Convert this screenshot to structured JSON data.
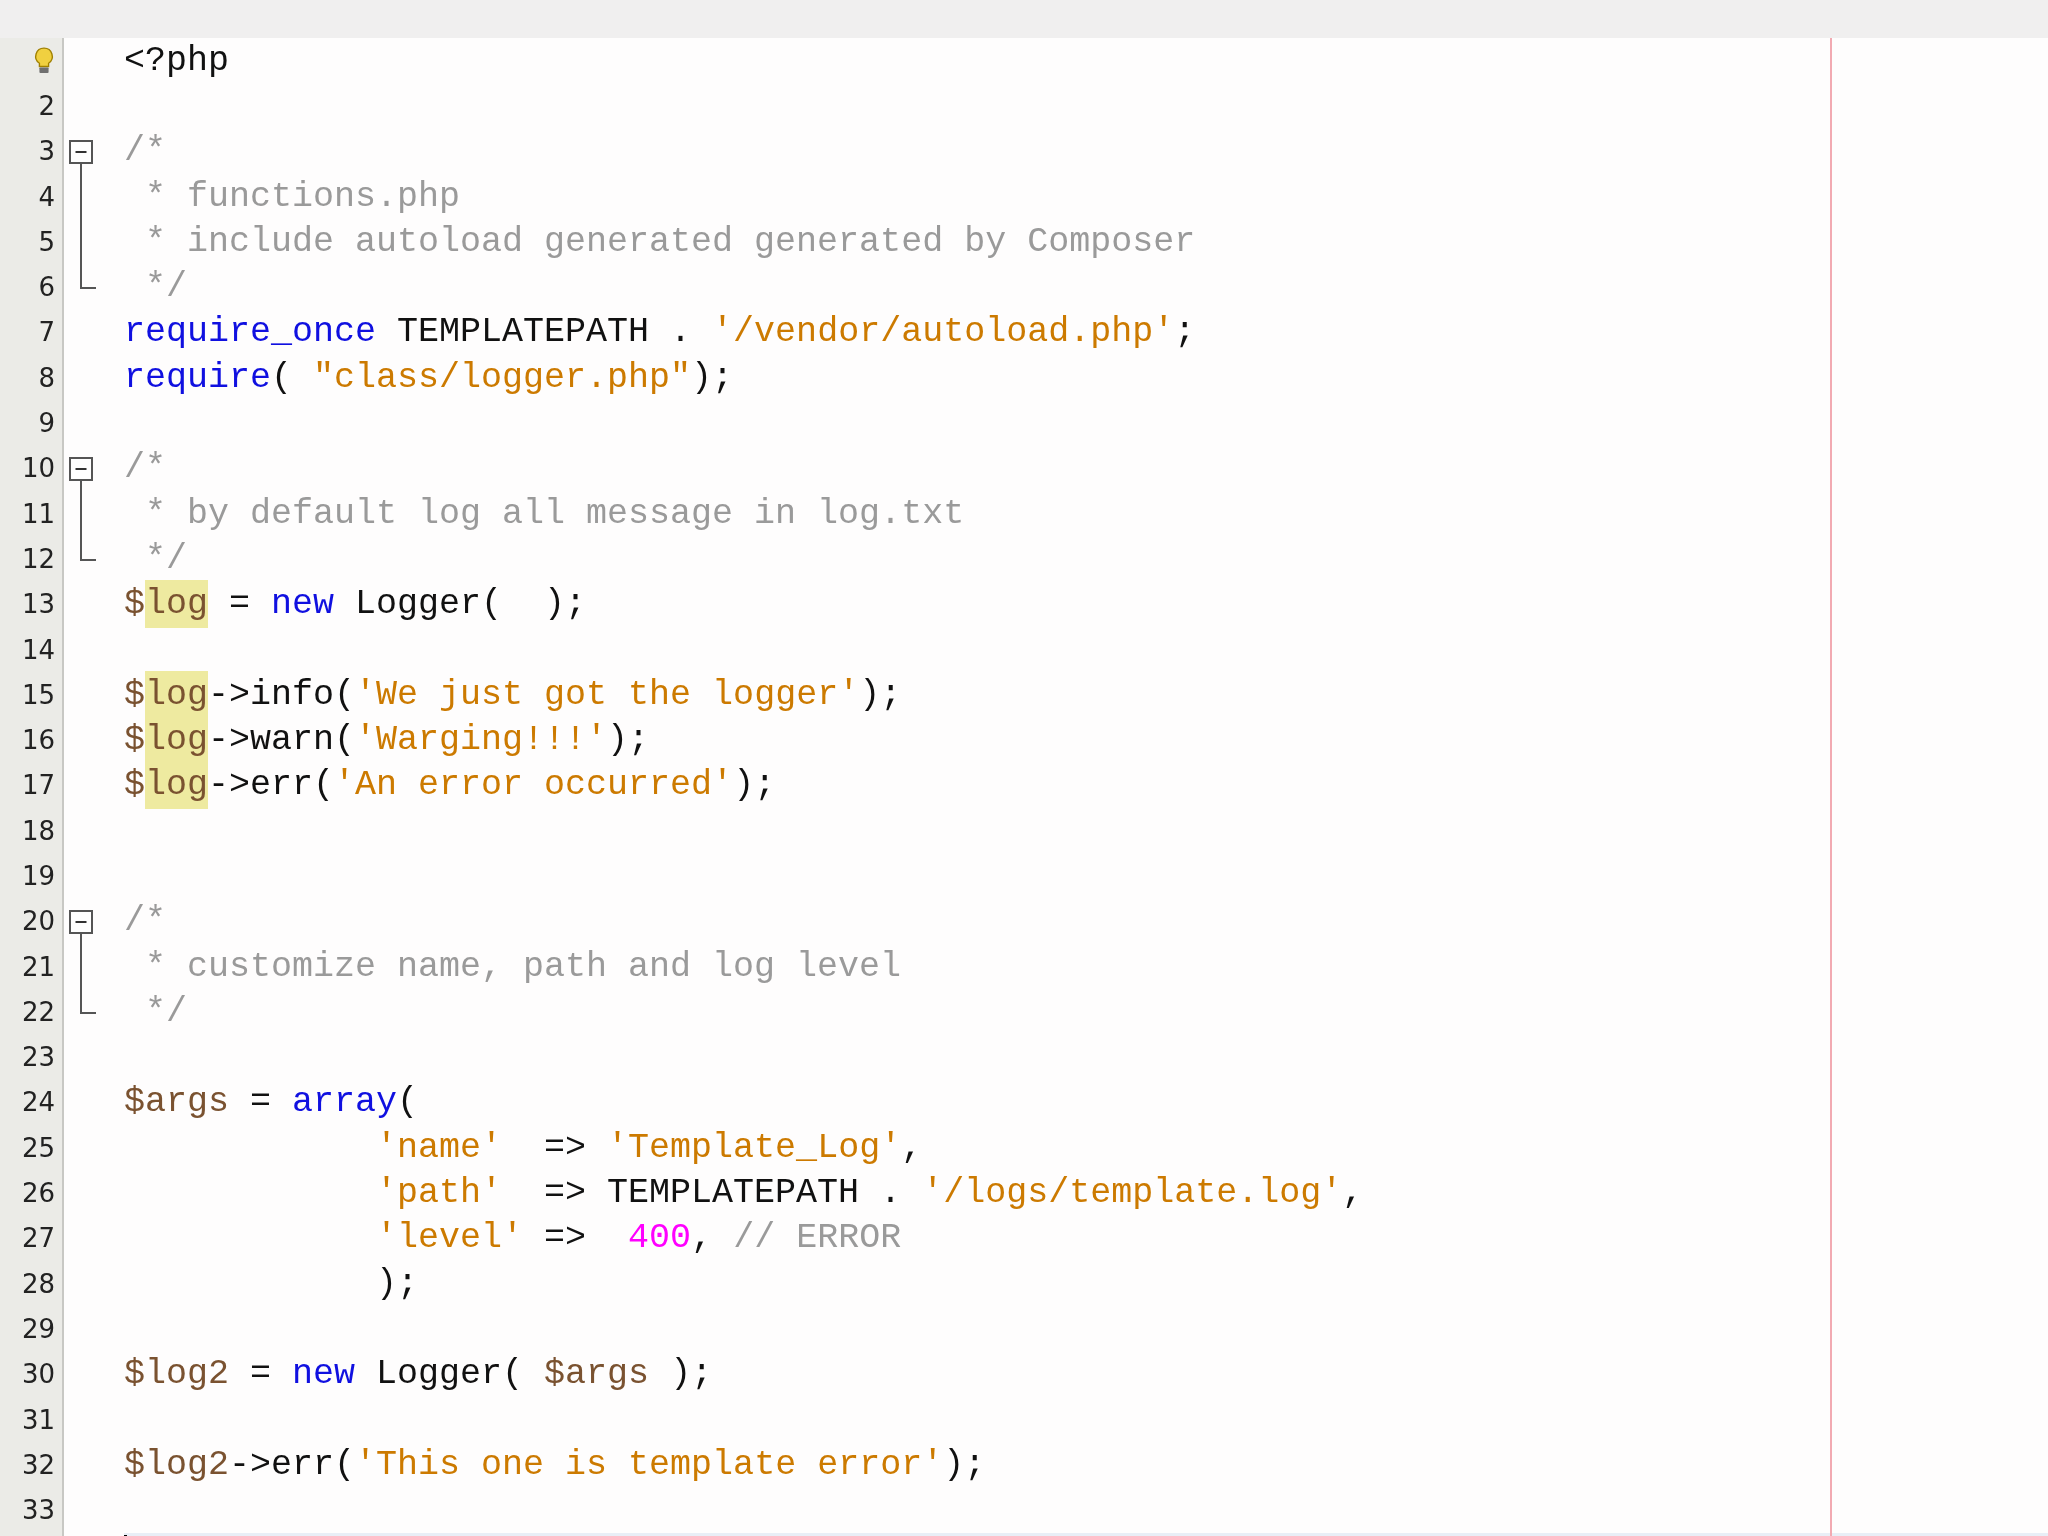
{
  "editor": {
    "lines": [
      {
        "hint": true,
        "kind": "plain",
        "tokens": [
          {
            "t": "<?php",
            "kind": "txt"
          }
        ]
      },
      {
        "number": "2",
        "kind": "plain"
      },
      {
        "number": "3",
        "kind": "fold_start",
        "tokens": [
          {
            "t": "/*",
            "kind": "com"
          }
        ]
      },
      {
        "number": "4",
        "kind": "fold_body",
        "tokens": [
          {
            "t": " * functions.php",
            "kind": "com"
          }
        ]
      },
      {
        "number": "5",
        "kind": "fold_body",
        "tokens": [
          {
            "t": " * include autoload generated generated by Composer",
            "kind": "com"
          }
        ]
      },
      {
        "number": "6",
        "kind": "fold_end",
        "tokens": [
          {
            "t": " */",
            "kind": "com"
          }
        ]
      },
      {
        "number": "7",
        "kind": "plain",
        "tokens": [
          {
            "t": "require_once",
            "kind": "kw"
          },
          {
            "t": " TEMPLATEPATH . ",
            "kind": "txt"
          },
          {
            "t": "'/vendor/autoload.php'",
            "kind": "str"
          },
          {
            "t": ";",
            "kind": "txt"
          }
        ]
      },
      {
        "number": "8",
        "kind": "plain",
        "tokens": [
          {
            "t": "require",
            "kind": "kw"
          },
          {
            "t": "( ",
            "kind": "txt"
          },
          {
            "t": "\"class/logger.php\"",
            "kind": "str"
          },
          {
            "t": ");",
            "kind": "txt"
          }
        ]
      },
      {
        "number": "9",
        "kind": "plain"
      },
      {
        "number": "10",
        "kind": "fold_start",
        "tokens": [
          {
            "t": "/*",
            "kind": "com"
          }
        ]
      },
      {
        "number": "11",
        "kind": "fold_body",
        "tokens": [
          {
            "t": " * by default log all message in log.txt",
            "kind": "com"
          }
        ]
      },
      {
        "number": "12",
        "kind": "fold_end",
        "tokens": [
          {
            "t": " */",
            "kind": "com"
          }
        ]
      },
      {
        "number": "13",
        "kind": "plain",
        "tokens": [
          {
            "t": "$",
            "kind": "var"
          },
          {
            "t": "log",
            "kind": "var",
            "highlighted": true
          },
          {
            "t": " = ",
            "kind": "txt"
          },
          {
            "t": "new",
            "kind": "kw"
          },
          {
            "t": " Logger(  );",
            "kind": "txt"
          }
        ]
      },
      {
        "number": "14",
        "kind": "plain"
      },
      {
        "number": "15",
        "kind": "plain",
        "tokens": [
          {
            "t": "$",
            "kind": "var"
          },
          {
            "t": "log",
            "kind": "var",
            "highlighted": true
          },
          {
            "t": "->info(",
            "kind": "txt"
          },
          {
            "t": "'We just got the logger'",
            "kind": "str"
          },
          {
            "t": ");",
            "kind": "txt"
          }
        ]
      },
      {
        "number": "16",
        "kind": "plain",
        "tokens": [
          {
            "t": "$",
            "kind": "var"
          },
          {
            "t": "log",
            "kind": "var",
            "highlighted": true
          },
          {
            "t": "->warn(",
            "kind": "txt"
          },
          {
            "t": "'Warging!!!'",
            "kind": "str"
          },
          {
            "t": ");",
            "kind": "txt"
          }
        ]
      },
      {
        "number": "17",
        "kind": "plain",
        "tokens": [
          {
            "t": "$",
            "kind": "var"
          },
          {
            "t": "log",
            "kind": "var",
            "highlighted": true
          },
          {
            "t": "->err(",
            "kind": "txt"
          },
          {
            "t": "'An error occurred'",
            "kind": "str"
          },
          {
            "t": ");",
            "kind": "txt"
          }
        ]
      },
      {
        "number": "18",
        "kind": "plain"
      },
      {
        "number": "19",
        "kind": "plain"
      },
      {
        "number": "20",
        "kind": "fold_start",
        "tokens": [
          {
            "t": "/*",
            "kind": "com"
          }
        ]
      },
      {
        "number": "21",
        "kind": "fold_body",
        "tokens": [
          {
            "t": " * customize name, path and log level",
            "kind": "com"
          }
        ]
      },
      {
        "number": "22",
        "kind": "fold_end",
        "tokens": [
          {
            "t": " */",
            "kind": "com"
          }
        ]
      },
      {
        "number": "23",
        "kind": "plain"
      },
      {
        "number": "24",
        "kind": "plain",
        "tokens": [
          {
            "t": "$args",
            "kind": "var"
          },
          {
            "t": " = ",
            "kind": "txt"
          },
          {
            "t": "array",
            "kind": "kw"
          },
          {
            "t": "(",
            "kind": "txt"
          }
        ]
      },
      {
        "number": "25",
        "kind": "plain",
        "tokens": [
          {
            "t": "            'name'",
            "kind": "str"
          },
          {
            "t": "  => ",
            "kind": "txt"
          },
          {
            "t": "'Template_Log'",
            "kind": "str"
          },
          {
            "t": ",",
            "kind": "txt"
          }
        ]
      },
      {
        "number": "26",
        "kind": "plain",
        "tokens": [
          {
            "t": "            'path'",
            "kind": "str"
          },
          {
            "t": "  => TEMPLATEPATH . ",
            "kind": "txt"
          },
          {
            "t": "'/logs/template.log'",
            "kind": "str"
          },
          {
            "t": ",",
            "kind": "txt"
          }
        ]
      },
      {
        "number": "27",
        "kind": "plain",
        "tokens": [
          {
            "t": "            'level'",
            "kind": "str"
          },
          {
            "t": " =>  ",
            "kind": "txt"
          },
          {
            "t": "400",
            "kind": "num"
          },
          {
            "t": ", ",
            "kind": "txt"
          },
          {
            "t": "// ERROR",
            "kind": "com"
          }
        ]
      },
      {
        "number": "28",
        "kind": "plain",
        "tokens": [
          {
            "t": "            );",
            "kind": "txt"
          }
        ]
      },
      {
        "number": "29",
        "kind": "plain"
      },
      {
        "number": "30",
        "kind": "plain",
        "tokens": [
          {
            "t": "$log2",
            "kind": "var"
          },
          {
            "t": " = ",
            "kind": "txt"
          },
          {
            "t": "new",
            "kind": "kw"
          },
          {
            "t": " Logger( ",
            "kind": "txt"
          },
          {
            "t": "$args",
            "kind": "var"
          },
          {
            "t": " );",
            "kind": "txt"
          }
        ]
      },
      {
        "number": "31",
        "kind": "plain"
      },
      {
        "number": "32",
        "kind": "plain",
        "tokens": [
          {
            "t": "$log2",
            "kind": "var"
          },
          {
            "t": "->err(",
            "kind": "txt"
          },
          {
            "t": "'This one is template error'",
            "kind": "str"
          },
          {
            "t": ");",
            "kind": "txt"
          }
        ]
      },
      {
        "number": "33",
        "kind": "plain"
      },
      {
        "kind": "plain",
        "current": true
      }
    ]
  }
}
